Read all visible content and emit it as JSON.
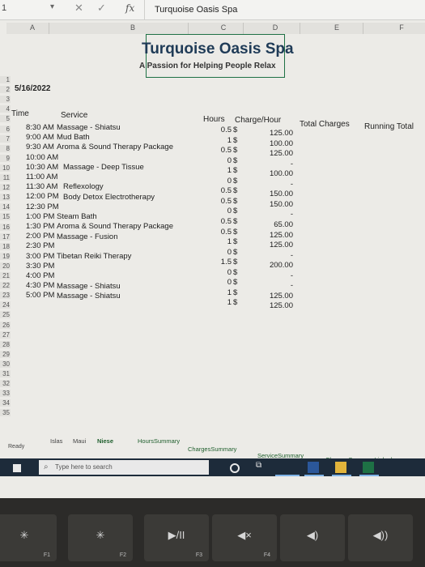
{
  "formula_bar": {
    "cell_ref": "1",
    "fx": "fx",
    "formula": "Turquoise Oasis Spa"
  },
  "columns": [
    "A",
    "B",
    "C",
    "D",
    "E",
    "F"
  ],
  "sheet": {
    "title": "Turquoise Oasis Spa",
    "subtitle": "A Passion for Helping People Relax",
    "date": "5/16/2022",
    "headers": {
      "time": "Time",
      "service": "Service",
      "hours": "Hours",
      "charge": "Charge/Hour",
      "total": "Total Charges",
      "running": "Running Total"
    },
    "rows": [
      {
        "time": "8:30 AM",
        "service": "Massage - Shiatsu",
        "hours": "0.5",
        "charge": "125.00"
      },
      {
        "time": "9:00 AM",
        "service": "Mud Bath",
        "hours": "1",
        "charge": "100.00"
      },
      {
        "time": "9:30 AM",
        "service": "Aroma & Sound Therapy Package",
        "hours": "0.5",
        "charge": "125.00"
      },
      {
        "time": "10:00 AM",
        "service": "",
        "hours": "0",
        "charge": "-"
      },
      {
        "time": "10:30 AM",
        "service": "Massage - Deep Tissue",
        "hours": "1",
        "charge": "100.00"
      },
      {
        "time": "11:00 AM",
        "service": "",
        "hours": "0",
        "charge": "-"
      },
      {
        "time": "11:30 AM",
        "service": "Reflexology",
        "hours": "0.5",
        "charge": "150.00"
      },
      {
        "time": "12:00 PM",
        "service": "Body Detox Electrotherapy",
        "hours": "0.5",
        "charge": "150.00"
      },
      {
        "time": "12:30 PM",
        "service": "",
        "hours": "0",
        "charge": "-"
      },
      {
        "time": "1:00 PM",
        "service": "Steam Bath",
        "hours": "0.5",
        "charge": "65.00"
      },
      {
        "time": "1:30 PM",
        "service": "Aroma & Sound Therapy Package",
        "hours": "0.5",
        "charge": "125.00"
      },
      {
        "time": "2:00 PM",
        "service": "Massage - Fusion",
        "hours": "1",
        "charge": "125.00"
      },
      {
        "time": "2:30 PM",
        "service": "",
        "hours": "0",
        "charge": "-"
      },
      {
        "time": "3:00 PM",
        "service": "Tibetan Reiki Therapy",
        "hours": "1.5",
        "charge": "200.00"
      },
      {
        "time": "3:30 PM",
        "service": "",
        "hours": "0",
        "charge": "-"
      },
      {
        "time": "4:00 PM",
        "service": "",
        "hours": "0",
        "charge": "-"
      },
      {
        "time": "4:30 PM",
        "service": "Massage - Shiatsu",
        "hours": "1",
        "charge": "125.00"
      },
      {
        "time": "5:00 PM",
        "service": "Massage - Shiatsu",
        "hours": "1",
        "charge": "125.00"
      }
    ],
    "dollar": "$"
  },
  "row_numbers": [
    "1",
    "2",
    "3",
    "4",
    "5",
    "6",
    "7",
    "8",
    "9",
    "10",
    "11",
    "12",
    "13",
    "14",
    "15",
    "16",
    "17",
    "18",
    "19",
    "20",
    "21",
    "22",
    "23",
    "24",
    "25",
    "26",
    "27",
    "28",
    "29",
    "30",
    "31",
    "32",
    "33",
    "34",
    "35"
  ],
  "sheet_tabs": [
    {
      "label": "Islas",
      "state": "normal"
    },
    {
      "label": "Maui",
      "state": "normal"
    },
    {
      "label": "Niese",
      "state": "active"
    },
    {
      "label": "HoursSummary",
      "state": "linked"
    },
    {
      "label": "ChargesSummary",
      "state": "linked"
    },
    {
      "label": "ServiceSummary",
      "state": "linked"
    },
    {
      "label": "ChargesSummaryLinked",
      "state": "linked"
    }
  ],
  "status_text": "Ready",
  "taskbar": {
    "search_placeholder": "Type here to search",
    "icons": [
      "windows-icon",
      "search-icon",
      "cortana-icon",
      "task-view-icon",
      "word-icon",
      "file-explorer-icon",
      "excel-icon"
    ]
  },
  "keyboard": [
    {
      "glyph": "✳",
      "fn": "F1"
    },
    {
      "glyph": "✳",
      "fn": "F2"
    },
    {
      "glyph": "▶/II",
      "fn": "F3"
    },
    {
      "glyph": "◀×",
      "fn": "F4"
    },
    {
      "glyph": "◀)",
      "fn": ""
    },
    {
      "glyph": "◀))",
      "fn": ""
    }
  ],
  "colors": {
    "title": "#1f3b57",
    "active_tab": "#1e5e2c",
    "taskbar": "#1d2b3a"
  }
}
